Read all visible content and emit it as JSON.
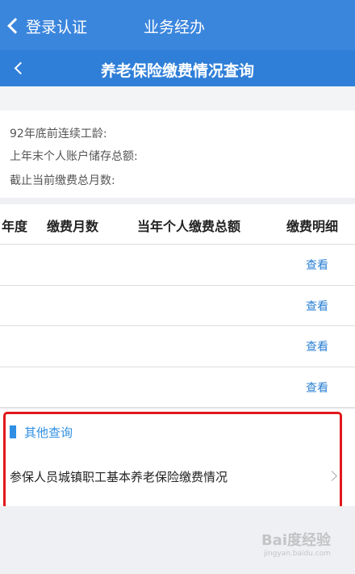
{
  "topbar": {
    "back_label": "登录认证",
    "title": "业务经办"
  },
  "navbar": {
    "title": "养老保险缴费情况查询"
  },
  "info": {
    "seniority_label": "92年底前连续工龄:",
    "balance_label": "上年末个人账户储存总额:",
    "months_label": "截止当前缴费总月数:"
  },
  "table": {
    "headers": [
      "年度",
      "缴费月数",
      "当年个人缴费总额",
      "缴费明细"
    ],
    "rows": [
      {
        "view_label": "查看"
      },
      {
        "view_label": "查看"
      },
      {
        "view_label": "查看"
      },
      {
        "view_label": "查看"
      }
    ]
  },
  "other": {
    "title": "其他查询",
    "item_label": "参保人员城镇职工基本养老保险缴费情况"
  },
  "watermark": {
    "text": "Bai度经验",
    "sub": "jingyan.baidu.com"
  },
  "colors": {
    "primary": "#3b86dd",
    "link": "#2a7fd4",
    "highlight": "#e0191b"
  }
}
